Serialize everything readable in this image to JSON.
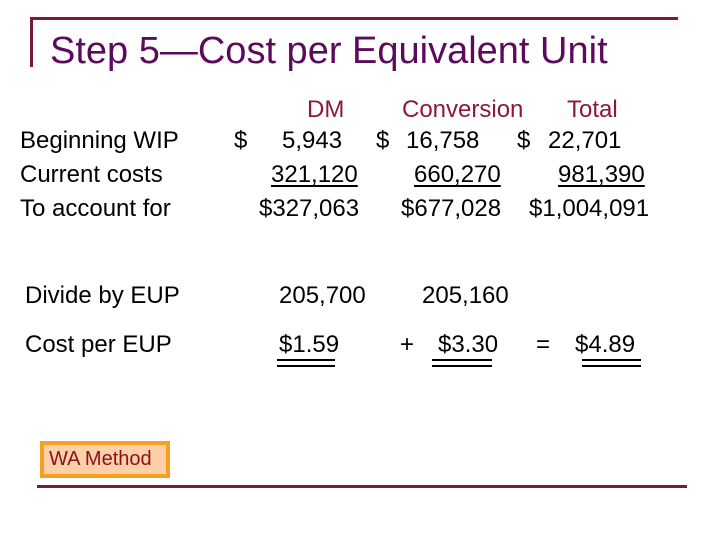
{
  "title": "Step 5—Cost per Equivalent Unit",
  "columns": {
    "dm": "DM",
    "conversion": "Conversion",
    "total": "Total"
  },
  "rows": {
    "beginning_wip": {
      "label": "Beginning WIP",
      "dm_sign": "$",
      "dm": "5,943",
      "conv_sign": "$",
      "conv": "16,758",
      "total_sign": "$",
      "total": "22,701"
    },
    "current_costs": {
      "label": "Current costs",
      "dm": "321,120",
      "conv": "660,270",
      "total": "981,390"
    },
    "to_account_for": {
      "label": "To account for",
      "dm": "$327,063",
      "conv": "$677,028",
      "total": "$1,004,091"
    },
    "divide_by_eup": {
      "label": "Divide by EUP",
      "dm": "205,700",
      "conv": "205,160"
    },
    "cost_per_eup": {
      "label": "Cost per EUP",
      "dm": "$1.59",
      "plus": "+",
      "conv": "$3.30",
      "equals": "=",
      "total": "$4.89"
    }
  },
  "badge": {
    "label": "WA Method"
  },
  "colors": {
    "title": "#5c0a5c",
    "header": "#8b1a3a",
    "frame": "#7a1a3a",
    "badge_border": "#f5a020",
    "badge_fill": "#fdd0a8",
    "badge_text": "#8b1020"
  }
}
